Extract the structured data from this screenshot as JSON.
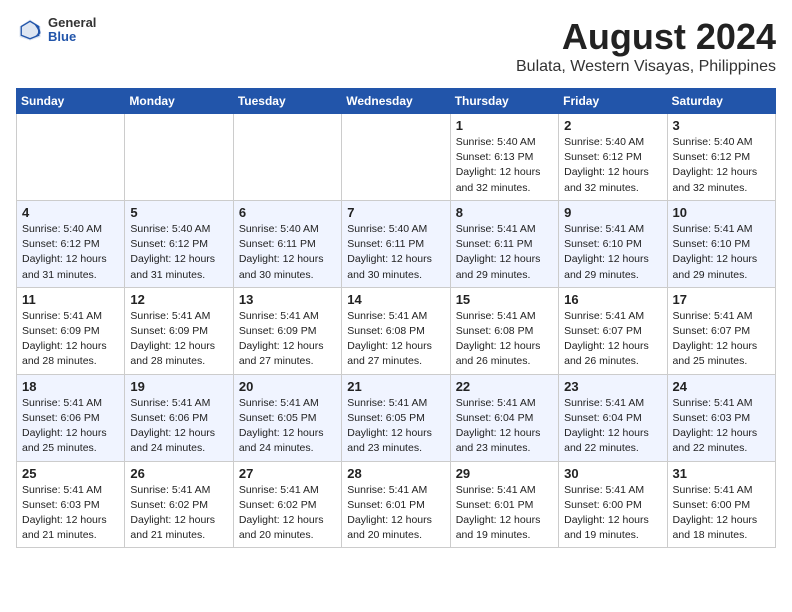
{
  "header": {
    "logo_general": "General",
    "logo_blue": "Blue",
    "main_title": "August 2024",
    "subtitle": "Bulata, Western Visayas, Philippines"
  },
  "days_of_week": [
    "Sunday",
    "Monday",
    "Tuesday",
    "Wednesday",
    "Thursday",
    "Friday",
    "Saturday"
  ],
  "weeks": [
    [
      {
        "day": "",
        "info": ""
      },
      {
        "day": "",
        "info": ""
      },
      {
        "day": "",
        "info": ""
      },
      {
        "day": "",
        "info": ""
      },
      {
        "day": "1",
        "info": "Sunrise: 5:40 AM\nSunset: 6:13 PM\nDaylight: 12 hours\nand 32 minutes."
      },
      {
        "day": "2",
        "info": "Sunrise: 5:40 AM\nSunset: 6:12 PM\nDaylight: 12 hours\nand 32 minutes."
      },
      {
        "day": "3",
        "info": "Sunrise: 5:40 AM\nSunset: 6:12 PM\nDaylight: 12 hours\nand 32 minutes."
      }
    ],
    [
      {
        "day": "4",
        "info": "Sunrise: 5:40 AM\nSunset: 6:12 PM\nDaylight: 12 hours\nand 31 minutes."
      },
      {
        "day": "5",
        "info": "Sunrise: 5:40 AM\nSunset: 6:12 PM\nDaylight: 12 hours\nand 31 minutes."
      },
      {
        "day": "6",
        "info": "Sunrise: 5:40 AM\nSunset: 6:11 PM\nDaylight: 12 hours\nand 30 minutes."
      },
      {
        "day": "7",
        "info": "Sunrise: 5:40 AM\nSunset: 6:11 PM\nDaylight: 12 hours\nand 30 minutes."
      },
      {
        "day": "8",
        "info": "Sunrise: 5:41 AM\nSunset: 6:11 PM\nDaylight: 12 hours\nand 29 minutes."
      },
      {
        "day": "9",
        "info": "Sunrise: 5:41 AM\nSunset: 6:10 PM\nDaylight: 12 hours\nand 29 minutes."
      },
      {
        "day": "10",
        "info": "Sunrise: 5:41 AM\nSunset: 6:10 PM\nDaylight: 12 hours\nand 29 minutes."
      }
    ],
    [
      {
        "day": "11",
        "info": "Sunrise: 5:41 AM\nSunset: 6:09 PM\nDaylight: 12 hours\nand 28 minutes."
      },
      {
        "day": "12",
        "info": "Sunrise: 5:41 AM\nSunset: 6:09 PM\nDaylight: 12 hours\nand 28 minutes."
      },
      {
        "day": "13",
        "info": "Sunrise: 5:41 AM\nSunset: 6:09 PM\nDaylight: 12 hours\nand 27 minutes."
      },
      {
        "day": "14",
        "info": "Sunrise: 5:41 AM\nSunset: 6:08 PM\nDaylight: 12 hours\nand 27 minutes."
      },
      {
        "day": "15",
        "info": "Sunrise: 5:41 AM\nSunset: 6:08 PM\nDaylight: 12 hours\nand 26 minutes."
      },
      {
        "day": "16",
        "info": "Sunrise: 5:41 AM\nSunset: 6:07 PM\nDaylight: 12 hours\nand 26 minutes."
      },
      {
        "day": "17",
        "info": "Sunrise: 5:41 AM\nSunset: 6:07 PM\nDaylight: 12 hours\nand 25 minutes."
      }
    ],
    [
      {
        "day": "18",
        "info": "Sunrise: 5:41 AM\nSunset: 6:06 PM\nDaylight: 12 hours\nand 25 minutes."
      },
      {
        "day": "19",
        "info": "Sunrise: 5:41 AM\nSunset: 6:06 PM\nDaylight: 12 hours\nand 24 minutes."
      },
      {
        "day": "20",
        "info": "Sunrise: 5:41 AM\nSunset: 6:05 PM\nDaylight: 12 hours\nand 24 minutes."
      },
      {
        "day": "21",
        "info": "Sunrise: 5:41 AM\nSunset: 6:05 PM\nDaylight: 12 hours\nand 23 minutes."
      },
      {
        "day": "22",
        "info": "Sunrise: 5:41 AM\nSunset: 6:04 PM\nDaylight: 12 hours\nand 23 minutes."
      },
      {
        "day": "23",
        "info": "Sunrise: 5:41 AM\nSunset: 6:04 PM\nDaylight: 12 hours\nand 22 minutes."
      },
      {
        "day": "24",
        "info": "Sunrise: 5:41 AM\nSunset: 6:03 PM\nDaylight: 12 hours\nand 22 minutes."
      }
    ],
    [
      {
        "day": "25",
        "info": "Sunrise: 5:41 AM\nSunset: 6:03 PM\nDaylight: 12 hours\nand 21 minutes."
      },
      {
        "day": "26",
        "info": "Sunrise: 5:41 AM\nSunset: 6:02 PM\nDaylight: 12 hours\nand 21 minutes."
      },
      {
        "day": "27",
        "info": "Sunrise: 5:41 AM\nSunset: 6:02 PM\nDaylight: 12 hours\nand 20 minutes."
      },
      {
        "day": "28",
        "info": "Sunrise: 5:41 AM\nSunset: 6:01 PM\nDaylight: 12 hours\nand 20 minutes."
      },
      {
        "day": "29",
        "info": "Sunrise: 5:41 AM\nSunset: 6:01 PM\nDaylight: 12 hours\nand 19 minutes."
      },
      {
        "day": "30",
        "info": "Sunrise: 5:41 AM\nSunset: 6:00 PM\nDaylight: 12 hours\nand 19 minutes."
      },
      {
        "day": "31",
        "info": "Sunrise: 5:41 AM\nSunset: 6:00 PM\nDaylight: 12 hours\nand 18 minutes."
      }
    ]
  ]
}
